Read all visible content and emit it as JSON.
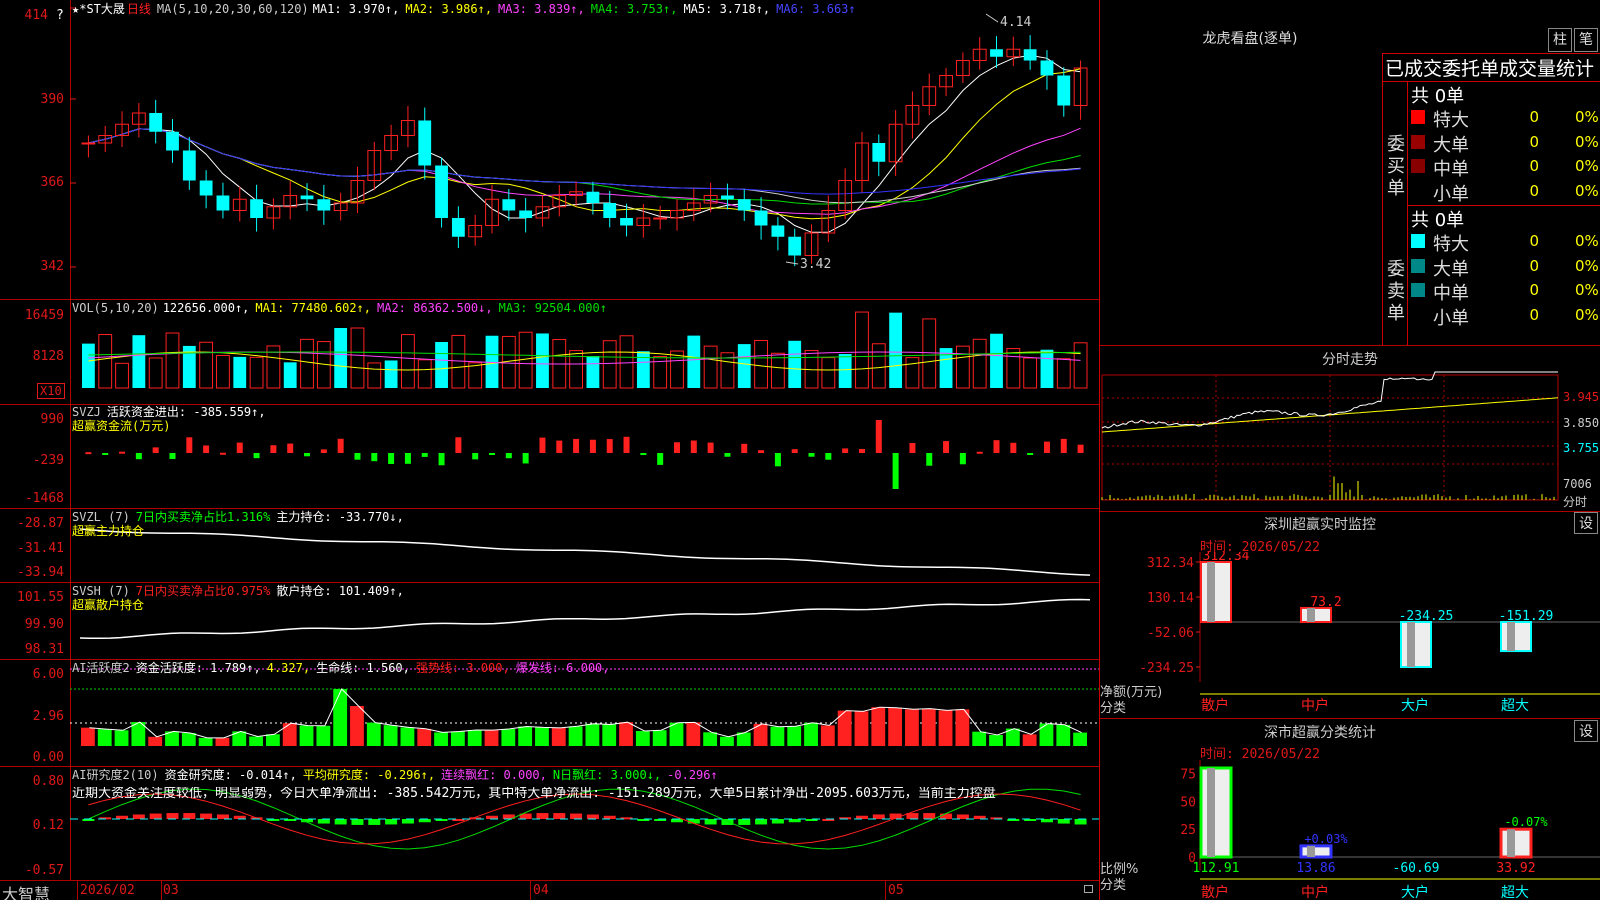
{
  "app": {
    "brand": "大智慧"
  },
  "main": {
    "title_stock": "★*ST大晟",
    "title_period": "日线",
    "ma_params": "MA(5,10,20,30,60,120)",
    "ma_readouts": [
      "MA1: 3.970↑,",
      "MA2: 3.986↑,",
      "MA3: 3.839↑,",
      "MA4: 3.753↑,",
      "MA5: 3.718↑,",
      "MA6: 3.663↑"
    ],
    "ma_colors": [
      "#ffffff",
      "#ffff00",
      "#ff44ff",
      "#00dd00",
      "#ffffff",
      "#4444ff"
    ],
    "y_labels": [
      "414",
      "390",
      "366",
      "342"
    ],
    "high_note": "4.14",
    "low_note": "3.42",
    "top_marker": "?"
  },
  "vol": {
    "title": "VOL(5,10,20)",
    "value": "122656.000↑,",
    "ma1": "MA1: 77480.602↑,",
    "ma2": "MA2: 86362.500↓,",
    "ma3": "MA3: 92504.000↑",
    "y_labels": [
      "16459",
      "8128"
    ],
    "unit": "X10"
  },
  "svzj": {
    "title": "SVZJ",
    "value": "活跃资金进出: -385.559↑,",
    "subtitle": "超赢资金流(万元)",
    "y_labels": [
      "990",
      "-239",
      "-1468"
    ]
  },
  "svzl": {
    "title": "SVZL (7)",
    "r1": "7日内买卖净占比1.316%",
    "r2": "主力持仓: -33.770↓,",
    "subtitle": "超赢主力持仓",
    "y_labels": [
      "-28.87",
      "-31.41",
      "-33.94"
    ]
  },
  "svsh": {
    "title": "SVSH (7)",
    "r1": "7日内买卖净占比0.975%",
    "r2": "散户持仓: 101.409↑,",
    "subtitle": "超赢散户持仓",
    "y_labels": [
      "101.55",
      "99.90",
      "98.31"
    ]
  },
  "ai1": {
    "title": "AI活跃度2",
    "v1": "资金活跃度: 1.789↑,",
    "v2": "4.327,",
    "v3": "生命线: 1.560,",
    "v4": "强势线: 3.000,",
    "v5": "爆发线: 6.000,",
    "y_labels": [
      "6.00",
      "2.96",
      "0.00"
    ]
  },
  "ai2": {
    "title": "AI研究度2(10)",
    "v1": "资金研究度: -0.014↑,",
    "v2": "平均研究度: -0.296↑,",
    "v3": "连续飘红: 0.000,",
    "v4": "N日飘红: 3.000↓,",
    "v5": "-0.296↑",
    "comment": "近期大资金关注度较低，明显弱势，今日大单净流出: -385.542万元，其中特大单净流出: -151.289万元，大单5日累计净出-2095.603万元，当前主力控盘",
    "y_labels": [
      "0.80",
      "0.12",
      "-0.57"
    ]
  },
  "xaxis": {
    "labels": [
      "2026/02",
      "03",
      "04",
      "05"
    ]
  },
  "dragon": {
    "title": "龙虎看盘(逐单)",
    "tab1": "柱",
    "tab2": "笔",
    "header": "已成交委托单成交量统计",
    "buy_label": "委买单",
    "sell_label": "委卖单",
    "buy_total": "共 0单",
    "sell_total": "共 0单",
    "rows": [
      {
        "name": "特大",
        "n": "0",
        "pct": "0%"
      },
      {
        "name": "大单",
        "n": "0",
        "pct": "0%"
      },
      {
        "name": "中单",
        "n": "0",
        "pct": "0%"
      },
      {
        "name": "小单",
        "n": "0",
        "pct": "0%"
      }
    ],
    "buy_colors": [
      "#ff0000",
      "#990000",
      "#880000",
      ""
    ],
    "sell_colors": [
      "#00ffff",
      "#008888",
      "#008888",
      ""
    ]
  },
  "intraday": {
    "title": "分时走势",
    "p1": "3.945",
    "p2": "3.850",
    "p3": "3.755",
    "vol": "7006",
    "unit": "分时"
  },
  "monitor": {
    "title": "深圳超赢实时监控",
    "settings": "设",
    "time": "时间: 2026/05/22",
    "y_labels": [
      "312.34",
      "130.14",
      "-52.06",
      "-234.25"
    ],
    "unit_label": "净额(万元)",
    "cat_label": "分类"
  },
  "classify": {
    "title": "深市超赢分类统计",
    "settings": "设",
    "time": "时间: 2026/05/22",
    "y_labels": [
      "75",
      "50",
      "25",
      "0"
    ],
    "unit_label": "比例%",
    "cat_label": "分类"
  },
  "chart_data": [
    {
      "type": "bar",
      "title": "深圳超赢实时监控",
      "categories": [
        "散户",
        "中户",
        "大户",
        "超大"
      ],
      "values": [
        312.34,
        73.2,
        -234.25,
        -151.29
      ],
      "ylabel": "净额(万元)",
      "ylim": [
        -234.25,
        312.34
      ],
      "colors": [
        "#ff2020",
        "#ff2020",
        "#00ffff",
        "#00ffff"
      ]
    },
    {
      "type": "bar",
      "title": "深市超赢分类统计",
      "categories": [
        "散户",
        "中户",
        "大户",
        "超大"
      ],
      "values": [
        112.91,
        13.86,
        -60.69,
        33.92
      ],
      "labels": [
        "",
        "+0.03%",
        "",
        "-0.07%"
      ],
      "ylabel": "比例%",
      "ylim": [
        0,
        80
      ],
      "colors": [
        "#00ff00",
        "#3333ff",
        "#00ffff",
        "#ff2020"
      ]
    }
  ]
}
